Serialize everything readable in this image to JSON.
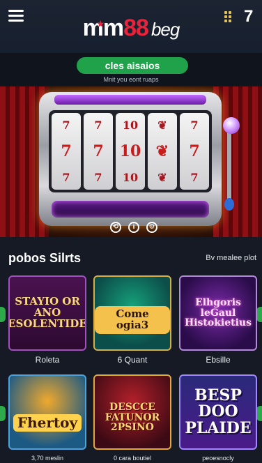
{
  "header": {
    "logo_mm": "mm",
    "logo_num": "88",
    "logo_beg": "beg",
    "badge": "7",
    "menu_icon": "hamburger-icon",
    "grid_icon": "grid-dots-icon"
  },
  "cta": {
    "label": "cles aisaios",
    "sub": "Mnit you  eont ruaps"
  },
  "hero": {
    "reels": [
      [
        "7",
        "7",
        "7"
      ],
      [
        "7",
        "7",
        "7"
      ],
      [
        "10",
        "10",
        "10"
      ],
      [
        "❦",
        "❦",
        "❦"
      ],
      [
        "7",
        "7",
        "7"
      ]
    ],
    "controls": [
      "⟲",
      "i",
      "⚙"
    ]
  },
  "section": {
    "title": "pobos Silrts",
    "link": "Bv mealee plot"
  },
  "games": [
    {
      "title": "STAYIO OR ANO LESOLENTIDES",
      "label": "Roleta"
    },
    {
      "title": "Come ogia3",
      "label": "6 Quant"
    },
    {
      "title": "Elhgoris leGaul Histokietius",
      "label": "Ebsille"
    },
    {
      "title": "Fhertoy",
      "label": "3,70 meslin"
    },
    {
      "title": "DESCCE FATUNOR 2PSINO",
      "label": "0 cara boutiel"
    },
    {
      "title": "BESP DOO PLAIDE",
      "label": "peoesnocly"
    }
  ],
  "colors": {
    "brand_red": "#e8243c",
    "cta_green": "#1fa24a",
    "background": "#151a24"
  }
}
